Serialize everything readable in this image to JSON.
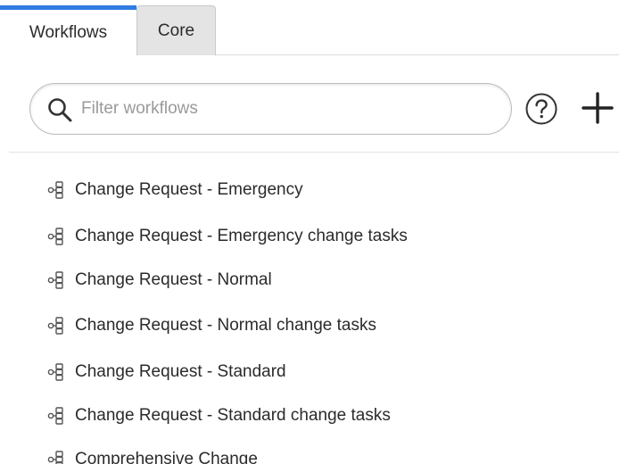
{
  "tabs": {
    "workflows_label": "Workflows",
    "core_label": "Core",
    "active": "Workflows"
  },
  "search": {
    "placeholder": "Filter workflows",
    "value": ""
  },
  "toolbar": {
    "help_icon": "help-circle-icon",
    "add_icon": "plus-icon"
  },
  "workflows": [
    {
      "label": "Change Request - Emergency"
    },
    {
      "label": "Change Request - Emergency change tasks"
    },
    {
      "label": "Change Request - Normal"
    },
    {
      "label": "Change Request - Normal change tasks"
    },
    {
      "label": "Change Request - Standard"
    },
    {
      "label": "Change Request - Standard change tasks"
    },
    {
      "label": "Comprehensive Change"
    }
  ],
  "colors": {
    "active_tab_accent": "#2f7de1",
    "inactive_tab_bg": "#e4e4e4",
    "text": "#2b2b2b",
    "placeholder": "#9a9a9a"
  }
}
